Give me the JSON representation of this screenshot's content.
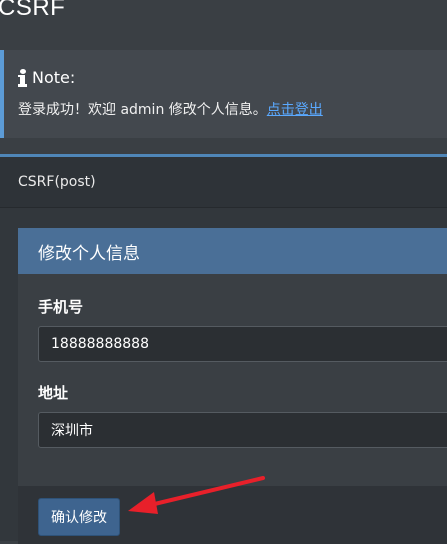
{
  "header": {
    "title": "CSRF"
  },
  "note": {
    "heading": "Note:",
    "message": "登录成功！欢迎 admin 修改个人信息。",
    "logout_link": "点击登出"
  },
  "card": {
    "title": "CSRF(post)"
  },
  "form": {
    "heading": "修改个人信息",
    "phone": {
      "label": "手机号",
      "value": "18888888888"
    },
    "address": {
      "label": "地址",
      "value": "深圳市"
    },
    "submit_label": "确认修改"
  },
  "colors": {
    "background": "#3a3f44",
    "accent": "#4f86b8",
    "panel_heading": "#4a6f97",
    "link": "#5aa9ff",
    "annotation_arrow": "#e8202a"
  }
}
